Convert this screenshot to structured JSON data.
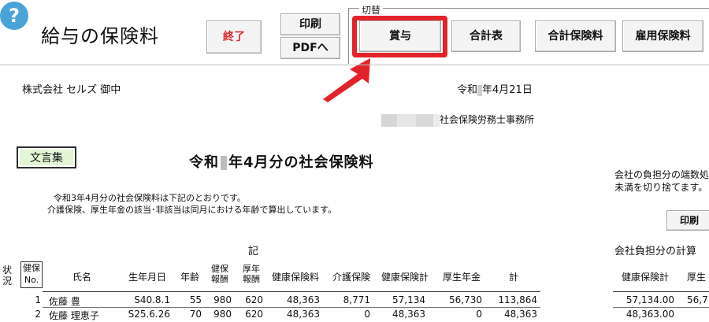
{
  "app": {
    "help_symbol": "?",
    "title": "給与の保険料"
  },
  "toolbar": {
    "exit_label": "終了",
    "print_label": "印刷",
    "pdf_label": "PDFへ",
    "switch_legend": "切替",
    "bonus_label": "賞与",
    "total_label": "合計表",
    "total_insurance_label": "合計保険料",
    "employment_insurance_label": "雇用保険料"
  },
  "colors": {
    "accent_red": "#e3232a",
    "help_blue": "#4aa3d8",
    "phrase_green": "#e3f5d4"
  },
  "document": {
    "company": "株式会社 セルズ 御中",
    "date_prefix": "令和",
    "date_suffix": "年4月21日",
    "office_name": "社会保険労務士事務所",
    "phrase_button": "文言集",
    "title_prefix": "令和",
    "title_suffix": "年4月分の社会保険料",
    "paragraph1": "令和3年4月分の社会保険料は下記のとおりです。",
    "paragraph2": "介護保険、厚生年金の該当･非該当は同月における年齢で算出しています。",
    "ki": "記",
    "right_note1": "会社の負担分の端数処",
    "right_note2": "未満を切り捨てます。",
    "right_print": "印刷",
    "calc_heading": "会社負担分の計算"
  },
  "table": {
    "headers": {
      "status": [
        "状",
        "況"
      ],
      "health_no": [
        "健保",
        "No."
      ],
      "name": "氏名",
      "birth": "生年月日",
      "age": "年齢",
      "health_comp": [
        "健保",
        "報酬"
      ],
      "pension_comp": [
        "厚年",
        "報酬"
      ],
      "health_ins": "健康保険料",
      "care_ins": "介護保険",
      "health_total": "健康保険計",
      "pension": "厚生年金",
      "total": "計"
    },
    "rows": [
      {
        "no": "1",
        "name": "佐藤 豊",
        "birth": "S40.8.1",
        "age": "55",
        "health_comp": "980",
        "pension_comp": "620",
        "health_ins": "48,363",
        "care_ins": "8,771",
        "health_total": "57,134",
        "pension": "56,730",
        "total": "113,864"
      },
      {
        "no": "2",
        "name": "佐藤 理恵子",
        "birth": "S25.6.26",
        "age": "70",
        "health_comp": "980",
        "pension_comp": "620",
        "health_ins": "48,363",
        "care_ins": "0",
        "health_total": "48,363",
        "pension": "0",
        "total": "48,363"
      }
    ],
    "right_headers": {
      "health_total": "健康保険計",
      "pension_short": "厚生"
    },
    "right_rows": [
      {
        "health_total": "57,134.00",
        "pension": "56,7"
      },
      {
        "health_total": "48,363.00",
        "pension": ""
      }
    ]
  }
}
